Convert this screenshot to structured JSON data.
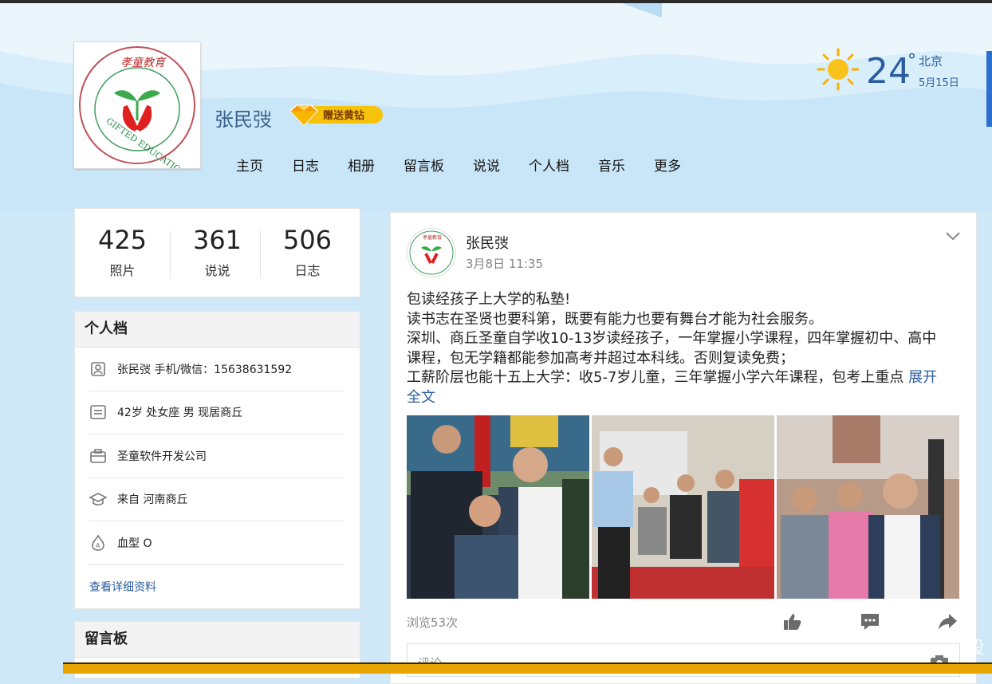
{
  "header": {
    "username": "张民弢",
    "vip_label": "赠送黄钻",
    "nav": [
      "主页",
      "日志",
      "相册",
      "留言板",
      "说说",
      "个人档",
      "音乐",
      "更多"
    ],
    "avatar_logo_text": "GIFTED EDUCATION",
    "avatar_logo_top_text": "孝童教育"
  },
  "weather": {
    "temp": "24",
    "degree": "°",
    "city": "北京",
    "date": "5月15日"
  },
  "stats": [
    {
      "num": "425",
      "label": "照片"
    },
    {
      "num": "361",
      "label": "说说"
    },
    {
      "num": "506",
      "label": "日志"
    }
  ],
  "profile": {
    "title": "个人档",
    "rows": [
      {
        "icon": "contact-card-icon",
        "text": "张民弢 手机/微信：15638631592"
      },
      {
        "icon": "info-card-icon",
        "text": "42岁  处女座 男 现居商丘"
      },
      {
        "icon": "briefcase-icon",
        "text": "圣童软件开发公司"
      },
      {
        "icon": "graduation-cap-icon",
        "text": "来自 河南商丘"
      },
      {
        "icon": "blood-drop-icon",
        "text": "血型 O"
      }
    ],
    "more_link": "查看详细资料"
  },
  "board": {
    "title": "留言板"
  },
  "post": {
    "author": "张民弢",
    "time": "3月8日 11:35",
    "lines": [
      "包读经孩子上大学的私塾!",
      "读书志在圣贤也要科第，既要有能力也要有舞台才能为社会服务。",
      "深圳、商丘圣童自学收10-13岁读经孩子，一年掌握小学课程，四年掌握初中、高中",
      "课程，包无学籍都能参加高考并超过本科线。否则复读免费；",
      "工薪阶层也能十五上大学：收5-7岁儿童，三年掌握小学六年课程，包考上重点 "
    ],
    "expand_1": "展开",
    "expand_2": "全文",
    "views": "浏览53次",
    "comment_placeholder": "评论"
  },
  "colors": {
    "accent": "#2a5d9f",
    "sky": "#cfe8f7",
    "vip": "#f5b800"
  },
  "watermark": "设"
}
